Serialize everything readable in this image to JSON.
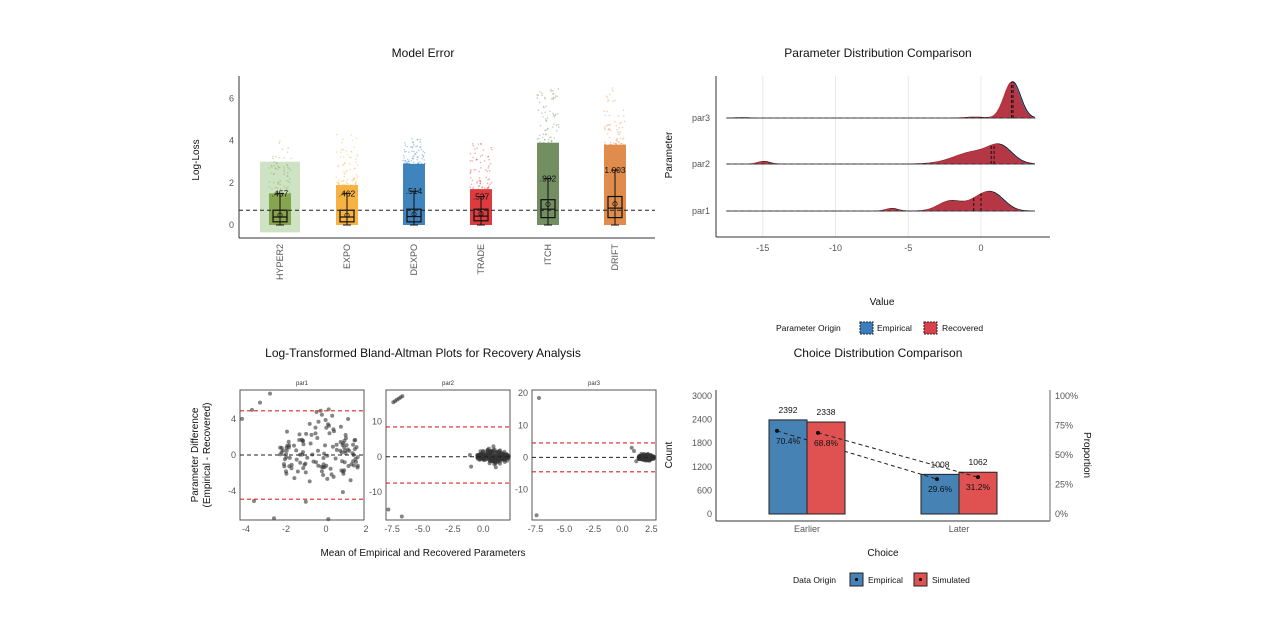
{
  "chart_data": [
    {
      "type": "boxplot",
      "title": "Model Error",
      "xlabel": "",
      "ylabel": "Log-Loss",
      "ylim": [
        -0.5,
        7
      ],
      "yticks": [
        0,
        2,
        4,
        6
      ],
      "reference_line": 0.7,
      "highlight_category": "HYPER2",
      "categories": [
        "HYPER2",
        "EXPO",
        "DEXPO",
        "TRADE",
        "ITCH",
        "DRIFT"
      ],
      "colors": [
        "#7a9a3a",
        "#f5a623",
        "#1f6fb2",
        "#d7191c",
        "#5a7a45",
        "#d9782d"
      ],
      "mean_labels": [
        ".457",
        ".462",
        ".514",
        ".537",
        ".982",
        "1.003"
      ],
      "means": [
        0.457,
        0.462,
        0.514,
        0.537,
        0.982,
        1.003
      ],
      "medians": [
        0.38,
        0.38,
        0.4,
        0.42,
        0.75,
        0.8
      ],
      "q1": [
        0.15,
        0.15,
        0.15,
        0.2,
        0.35,
        0.35
      ],
      "q3": [
        0.7,
        0.7,
        0.75,
        0.75,
        1.2,
        1.35
      ],
      "whisker_low": [
        0,
        0,
        0,
        0,
        0,
        0
      ],
      "whisker_high": [
        1.5,
        1.5,
        1.6,
        1.35,
        2.2,
        2.6
      ],
      "max_points": [
        4.0,
        4.4,
        4.1,
        4.0,
        6.5,
        6.6
      ],
      "dense_top": [
        1.5,
        1.9,
        2.9,
        1.7,
        3.9,
        3.8
      ]
    },
    {
      "type": "ridgeline",
      "title": "Parameter Distribution Comparison",
      "xlabel": "Value",
      "ylabel": "Parameter",
      "xlim": [
        -17.5,
        3.7
      ],
      "xticks": [
        -15,
        -10,
        -5,
        0
      ],
      "legend_title": "Parameter Origin",
      "legend_position": "bottom",
      "legend": [
        {
          "name": "Empirical",
          "color": "#3b7dbf"
        },
        {
          "name": "Recovered",
          "color": "#d9424a"
        }
      ],
      "rows": [
        {
          "name": "par1",
          "modes": [
            {
              "x": -6.2,
              "h": 0.12,
              "w": 0.4
            },
            {
              "x": -2.2,
              "h": 0.45,
              "w": 0.8
            },
            {
              "x": -0.3,
              "h": 0.4,
              "w": 0.8
            },
            {
              "x": 0.8,
              "h": 0.7,
              "w": 0.8
            }
          ],
          "medians": [
            0.0,
            -0.5
          ]
        },
        {
          "name": "par2",
          "modes": [
            {
              "x": -15.0,
              "h": 0.12,
              "w": 0.4
            },
            {
              "x": -0.5,
              "h": 0.55,
              "w": 1.4
            },
            {
              "x": 1.3,
              "h": 0.65,
              "w": 0.8
            }
          ],
          "medians": [
            0.7,
            0.9
          ]
        },
        {
          "name": "par3",
          "modes": [
            {
              "x": -16.5,
              "h": 0.02,
              "w": 0.4
            },
            {
              "x": -0.5,
              "h": 0.04,
              "w": 0.6
            },
            {
              "x": 2.1,
              "h": 1.65,
              "w": 0.55
            }
          ],
          "medians": [
            2.1,
            2.2
          ]
        }
      ]
    },
    {
      "type": "scatter",
      "title": "Log-Transformed Bland-Altman Plots for Recovery Analysis",
      "xlabel": "Mean of Empirical and Recovered Parameters",
      "ylabel": "Parameter Difference\n(Empirical - Recovered)",
      "panels": [
        {
          "name": "par1",
          "xlim": [
            -4.3,
            1.9
          ],
          "ylim": [
            -7.2,
            7.2
          ],
          "xticks": [
            -4,
            -2,
            0,
            2
          ],
          "xtick_labels": [
            "-4",
            "-2",
            "0",
            "2"
          ],
          "yticks": [
            -4,
            0,
            4
          ],
          "limits": [
            4.9,
            -4.9
          ],
          "bias": 0
        },
        {
          "name": "par2",
          "xlim": [
            -8.0,
            2.2
          ],
          "ylim": [
            -18,
            19
          ],
          "xticks": [
            -7.5,
            -5,
            -2.5,
            0
          ],
          "xtick_labels": [
            "-7.5",
            "-5.0",
            "-2.5",
            "0.0"
          ],
          "yticks": [
            -10,
            0,
            10
          ],
          "limits": [
            8.5,
            -7.5
          ],
          "bias": 0
        },
        {
          "name": "par3",
          "xlim": [
            -7.8,
            2.9
          ],
          "ylim": [
            -19.5,
            21
          ],
          "xticks": [
            -7.5,
            -5,
            -2.5,
            0,
            2.5
          ],
          "xtick_labels": [
            "-7.5",
            "-5.0",
            "-2.5",
            "0.0",
            "2.5"
          ],
          "yticks": [
            -10,
            0,
            10,
            20
          ],
          "limits": [
            4.5,
            -4.5
          ],
          "bias": 0
        }
      ]
    },
    {
      "type": "bar",
      "title": "Choice Distribution Comparison",
      "xlabel": "Choice",
      "ylabel": "Count",
      "ylabel_right": "Proportion",
      "ylim": [
        0,
        3000
      ],
      "yticks": [
        0,
        600,
        1200,
        1800,
        2400,
        3000
      ],
      "yticks_right": [
        "0%",
        "25%",
        "50%",
        "75%",
        "100%"
      ],
      "categories": [
        "Earlier",
        "Later"
      ],
      "legend_title": "Data Origin",
      "legend_position": "bottom",
      "series": [
        {
          "name": "Empirical",
          "color": "#4682b4",
          "values": [
            2392,
            1008
          ],
          "proportions": [
            70.4,
            29.6
          ],
          "prop_labels": [
            "70.4%",
            "29.6%"
          ]
        },
        {
          "name": "Simulated",
          "color": "#e05252",
          "values": [
            2338,
            1062
          ],
          "proportions": [
            68.8,
            31.2
          ],
          "prop_labels": [
            "68.8%",
            "31.2%"
          ]
        }
      ]
    }
  ]
}
